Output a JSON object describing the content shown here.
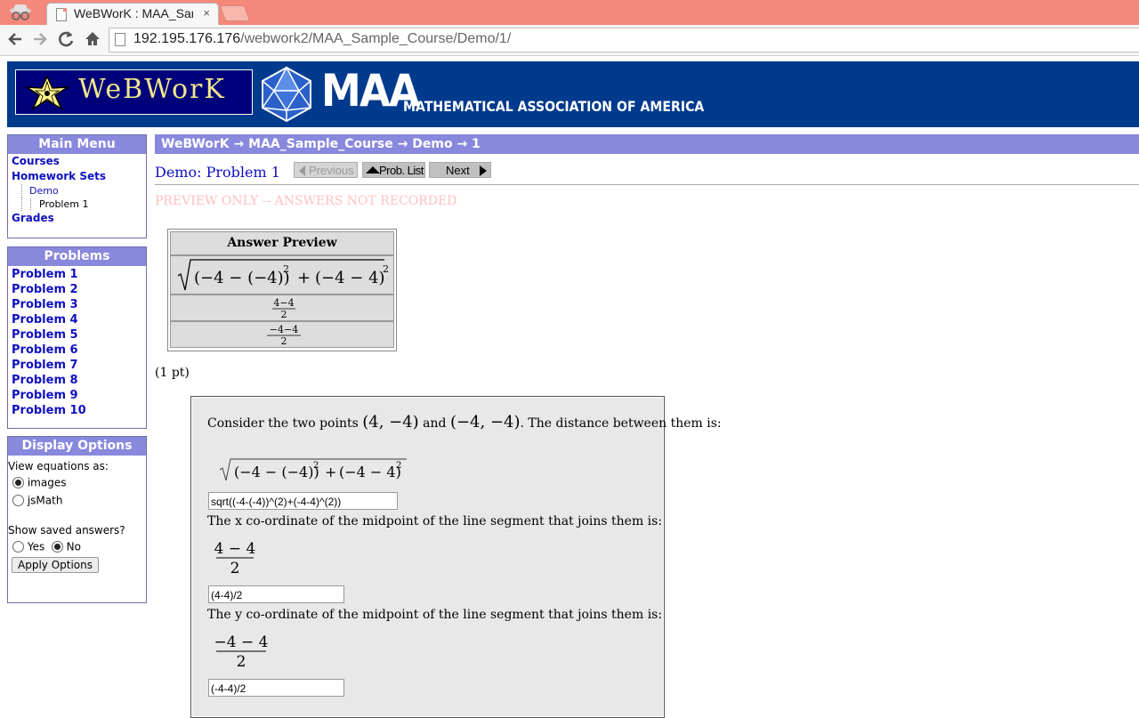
{
  "browser": {
    "tab_title": "WeBWorK : MAA_Sample_Course",
    "tab_close": "×",
    "url_host": "192.195.176.176",
    "url_path": "/webwork2/MAA_Sample_Course/Demo/1/"
  },
  "banner": {
    "webwork_logo": "WeBWorK",
    "maa_logo": "MAA",
    "maa_name": "MATHEMATICAL ASSOCIATION OF AMERICA"
  },
  "main_menu": {
    "title": "Main Menu",
    "courses": "Courses",
    "homework_sets": "Homework Sets",
    "set": "Demo",
    "problem": "Problem 1",
    "grades": "Grades"
  },
  "problems_menu": {
    "title": "Problems",
    "items": [
      "Problem 1",
      "Problem 2",
      "Problem 3",
      "Problem 4",
      "Problem 5",
      "Problem 6",
      "Problem 7",
      "Problem 8",
      "Problem 9",
      "Problem 10"
    ]
  },
  "display_options": {
    "title": "Display Options",
    "view_label": "View equations as:",
    "view_options": [
      "images",
      "jsMath"
    ],
    "view_selected": "images",
    "saved_label": "Show saved answers?",
    "saved_yes": "Yes",
    "saved_no": "No",
    "saved_selected": "No",
    "apply": "Apply Options"
  },
  "breadcrumb": "WeBWorK → MAA_Sample_Course → Demo → 1",
  "problem": {
    "title": "Demo: Problem 1",
    "prev": "Previous",
    "list": "Prob. List",
    "next": "Next",
    "preview_notice": "PREVIEW ONLY -- ANSWERS NOT RECORDED",
    "answer_preview_header": "Answer Preview",
    "points": "(1 pt)",
    "intro": "Consider the two points",
    "intro_and": "and",
    "intro_end": ". The distance between them is:",
    "point1": "(4, −4)",
    "point2": "(−4, −4)",
    "q2": "The x co-ordinate of the midpoint of the line segment that joins them is:",
    "q3": "The y co-ordinate of the midpoint of the line segment that joins them is:",
    "answer1": "sqrt((-4-(-4))^(2)+(-4-4)^(2))",
    "answer2": "(4-4)/2",
    "answer3": "(-4-4)/2",
    "math_sqrt_inner_a": "(−4 − (−4))",
    "math_plus": "+",
    "math_sqrt_inner_b": "(−4 − 4)",
    "math_exp": "2",
    "math_frac1_num": "4 − 4",
    "math_frac2_num": "−4 − 4",
    "math_frac_den": "2",
    "prev_frac1_num": "4−4",
    "prev_frac2_num": "−4−4"
  },
  "colors": {
    "banner": "#003a8c",
    "menu_header": "#8888dd",
    "link": "#1010c0",
    "preview_notice": "#ffc0c0"
  }
}
